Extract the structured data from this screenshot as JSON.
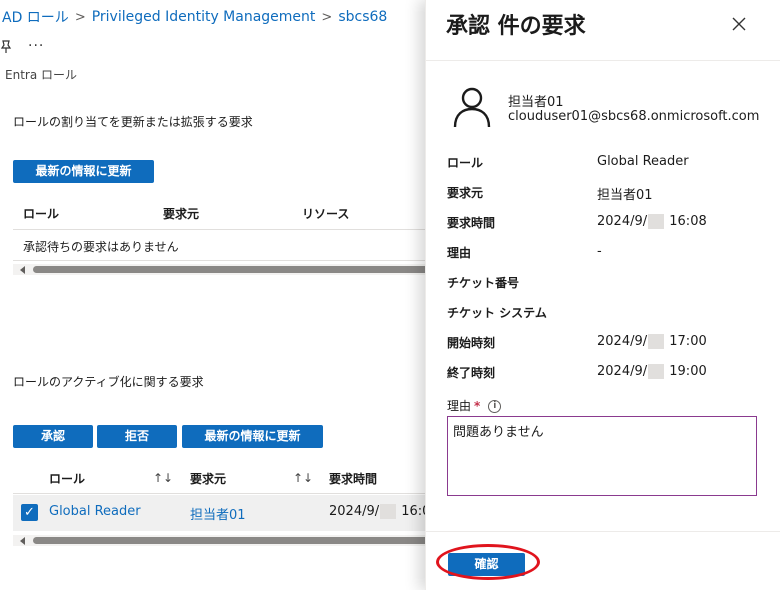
{
  "breadcrumb": {
    "item1": "AD ロール",
    "item2": "Privileged Identity Management",
    "item3": "sbcs68",
    "sep": ">"
  },
  "toolbar": {
    "more_label": "···"
  },
  "page": {
    "subtitle": "Entra ロール"
  },
  "section1": {
    "title": "ロールの割り当てを更新または拡張する要求",
    "refresh_label": "最新の情報に更新",
    "columns": [
      "ロール",
      "要求元",
      "リソース"
    ],
    "empty_text": "承認待ちの要求はありません"
  },
  "section2": {
    "title": "ロールのアクティブ化に関する要求",
    "approve_label": "承認",
    "deny_label": "拒否",
    "refresh_label": "最新の情報に更新",
    "columns": [
      "ロール",
      "要求元",
      "要求時間"
    ],
    "sort_glyph": "↑↓",
    "row": {
      "role": "Global Reader",
      "requester": "担当者01",
      "time_prefix": "2024/9/",
      "time_suffix": " 16:0"
    }
  },
  "panel": {
    "title": "承認 件の要求",
    "user": {
      "name": "担当者01",
      "email": "clouduser01@sbcs68.onmicrosoft.com"
    },
    "details": {
      "role_label": "ロール",
      "role_value": "Global Reader",
      "requester_label": "要求元",
      "requester_value": "担当者01",
      "request_time_label": "要求時間",
      "request_time_prefix": "2024/9/",
      "request_time_suffix": "16:08",
      "reason_label": "理由",
      "reason_value": "-",
      "ticket_number_label": "チケット番号",
      "ticket_system_label": "チケット システム",
      "start_label": "開始時刻",
      "start_prefix": "2024/9/",
      "start_suffix": "17:00",
      "end_label": "終了時刻",
      "end_prefix": "2024/9/",
      "end_suffix": "19:00"
    },
    "reason_field": {
      "label": "理由",
      "required_mark": "*",
      "info_glyph": "i",
      "value": "問題ありません"
    },
    "confirm_label": "確認"
  },
  "colors": {
    "accent": "#0f6cbd",
    "highlight_circle": "#e0141d"
  }
}
